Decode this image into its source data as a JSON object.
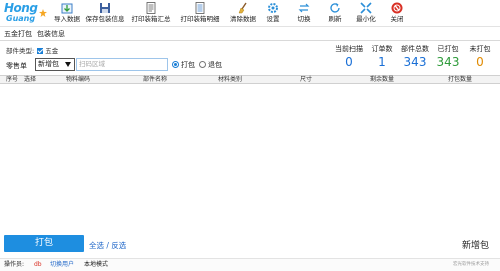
{
  "logo": {
    "line1": "Hong",
    "line2": "Guang"
  },
  "toolbar": {
    "items": [
      {
        "label": "导入数据",
        "icon": "import-icon"
      },
      {
        "label": "保存包装信息",
        "icon": "save-icon"
      },
      {
        "label": "打印装箱汇总",
        "icon": "print-summary-icon"
      },
      {
        "label": "打印装箱明细",
        "icon": "print-detail-icon"
      },
      {
        "label": "清除数据",
        "icon": "broom-icon"
      },
      {
        "label": "设置",
        "icon": "gear-icon"
      },
      {
        "label": "切换",
        "icon": "switch-icon"
      },
      {
        "label": "刷新",
        "icon": "refresh-icon"
      },
      {
        "label": "最小化",
        "icon": "minimize-icon"
      },
      {
        "label": "关闭",
        "icon": "close-icon"
      }
    ]
  },
  "tabs": {
    "t1": "五金打包",
    "t2": "包装信息"
  },
  "filter": {
    "label": "部件类型:",
    "option": "五金"
  },
  "order": {
    "label": "零售单",
    "mode_value": "新增包",
    "scan_placeholder": "扫码区域",
    "radio_pack": "打包",
    "radio_unpack": "退包"
  },
  "stats": [
    {
      "label": "当前扫描",
      "value": "0",
      "color": "#1a6fd6"
    },
    {
      "label": "订单数",
      "value": "1",
      "color": "#1a6fd6"
    },
    {
      "label": "部件总数",
      "value": "343",
      "color": "#1a6fd6"
    },
    {
      "label": "已打包",
      "value": "343",
      "color": "#2e9b3a"
    },
    {
      "label": "未打包",
      "value": "0",
      "color": "#e08a00"
    }
  ],
  "columns": [
    "序号",
    "选择",
    "物料编码",
    "部件名称",
    "材料类别",
    "尺寸",
    "剩余数量",
    "打包数量"
  ],
  "bottom": {
    "pack_button": "打包",
    "select_all": "全选 / 反选",
    "mode_label": "新增包"
  },
  "statusbar": {
    "operator_label": "操作员:",
    "operator_value": "db",
    "switch_user": "切换用户",
    "mode": "本地模式",
    "right_text": "宏光软件技术支持"
  },
  "colors": {
    "accent": "#1e8ee0",
    "link": "#1a63c7"
  }
}
